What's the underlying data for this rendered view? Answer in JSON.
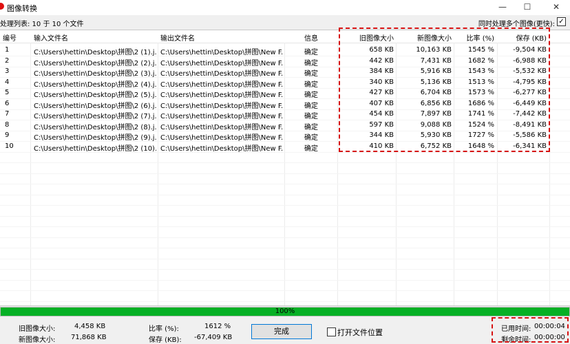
{
  "window": {
    "title": "图像转换"
  },
  "status": {
    "processing": "处理列表: 10 于 10 个文件",
    "multi_label": "同时处理多个图像(更快):",
    "multi_checked": "✓"
  },
  "columns": [
    "编号",
    "输入文件名",
    "输出文件名",
    "信息",
    "旧图像大小",
    "新图像大小",
    "比率 (%)",
    "保存 (KB)"
  ],
  "rows": [
    [
      "1",
      "C:\\Users\\hettin\\Desktop\\拼图\\2 (1).j...",
      "C:\\Users\\hettin\\Desktop\\拼图\\New F...",
      "确定",
      "658 KB",
      "10,163 KB",
      "1545 %",
      "-9,504 KB"
    ],
    [
      "2",
      "C:\\Users\\hettin\\Desktop\\拼图\\2 (2).j...",
      "C:\\Users\\hettin\\Desktop\\拼图\\New F...",
      "确定",
      "442 KB",
      "7,431 KB",
      "1682 %",
      "-6,988 KB"
    ],
    [
      "3",
      "C:\\Users\\hettin\\Desktop\\拼图\\2 (3).j...",
      "C:\\Users\\hettin\\Desktop\\拼图\\New F...",
      "确定",
      "384 KB",
      "5,916 KB",
      "1543 %",
      "-5,532 KB"
    ],
    [
      "4",
      "C:\\Users\\hettin\\Desktop\\拼图\\2 (4).j...",
      "C:\\Users\\hettin\\Desktop\\拼图\\New F...",
      "确定",
      "340 KB",
      "5,136 KB",
      "1513 %",
      "-4,795 KB"
    ],
    [
      "5",
      "C:\\Users\\hettin\\Desktop\\拼图\\2 (5).j...",
      "C:\\Users\\hettin\\Desktop\\拼图\\New F...",
      "确定",
      "427 KB",
      "6,704 KB",
      "1573 %",
      "-6,277 KB"
    ],
    [
      "6",
      "C:\\Users\\hettin\\Desktop\\拼图\\2 (6).j...",
      "C:\\Users\\hettin\\Desktop\\拼图\\New F...",
      "确定",
      "407 KB",
      "6,856 KB",
      "1686 %",
      "-6,449 KB"
    ],
    [
      "7",
      "C:\\Users\\hettin\\Desktop\\拼图\\2 (7).j...",
      "C:\\Users\\hettin\\Desktop\\拼图\\New F...",
      "确定",
      "454 KB",
      "7,897 KB",
      "1741 %",
      "-7,442 KB"
    ],
    [
      "8",
      "C:\\Users\\hettin\\Desktop\\拼图\\2 (8).j...",
      "C:\\Users\\hettin\\Desktop\\拼图\\New F...",
      "确定",
      "597 KB",
      "9,088 KB",
      "1524 %",
      "-8,491 KB"
    ],
    [
      "9",
      "C:\\Users\\hettin\\Desktop\\拼图\\2 (9).j...",
      "C:\\Users\\hettin\\Desktop\\拼图\\New F...",
      "确定",
      "344 KB",
      "5,930 KB",
      "1727 %",
      "-5,586 KB"
    ],
    [
      "10",
      "C:\\Users\\hettin\\Desktop\\拼图\\2 (10)...",
      "C:\\Users\\hettin\\Desktop\\拼图\\New F...",
      "确定",
      "410 KB",
      "6,752 KB",
      "1648 %",
      "-6,341 KB"
    ]
  ],
  "progress": {
    "label": "100%",
    "percent": 100
  },
  "summary": {
    "old_label": "旧图像大小:",
    "old_value": "4,458 KB",
    "new_label": "新图像大小:",
    "new_value": "71,868 KB",
    "ratio_label": "比率 (%):",
    "ratio_value": "1612 %",
    "save_label": "保存 (KB):",
    "save_value": "-67,409 KB",
    "elapsed_label": "已用时间:",
    "elapsed_value": "00:00:04",
    "remaining_label": "剩余时间:",
    "remaining_value": "00:00:00"
  },
  "buttons": {
    "done": "完成",
    "open_location": "打开文件位置"
  },
  "colors": {
    "progress": "#06b025",
    "highlight": "#d61010"
  }
}
